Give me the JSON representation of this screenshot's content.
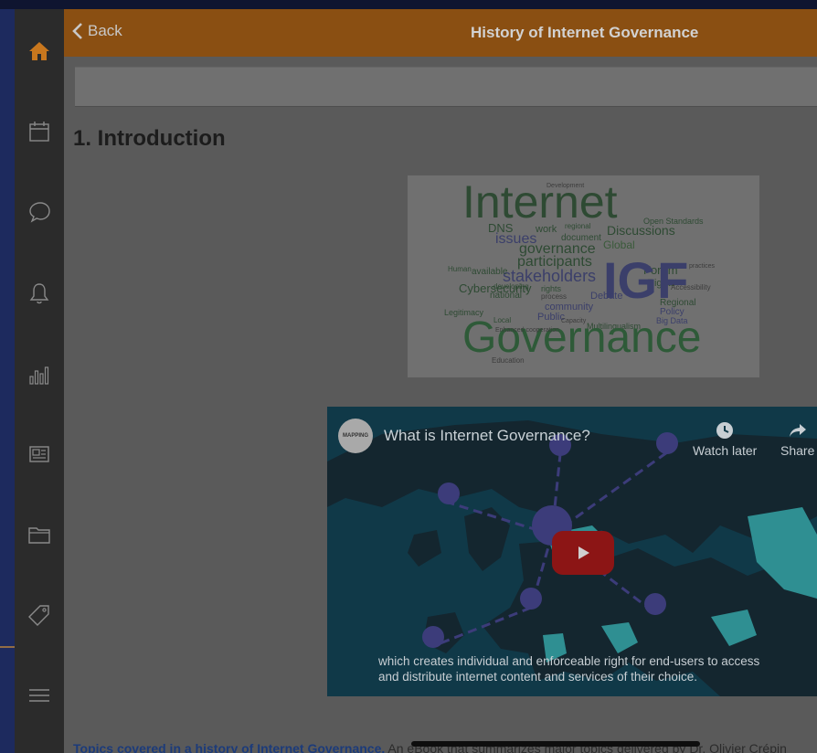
{
  "header": {
    "back_label": "Back",
    "title": "History of Internet Governance"
  },
  "sidebar": {
    "items": [
      {
        "icon": "home-icon",
        "active": true
      },
      {
        "icon": "calendar-icon"
      },
      {
        "icon": "chat-icon"
      },
      {
        "icon": "bell-icon"
      },
      {
        "icon": "bar-chart-icon"
      },
      {
        "icon": "news-icon"
      },
      {
        "icon": "folder-icon"
      },
      {
        "icon": "tag-icon"
      },
      {
        "icon": "menu-icon"
      }
    ]
  },
  "content": {
    "section_title": "1. Introduction",
    "wordcloud": {
      "words": [
        "Internet",
        "Development",
        "DNS",
        "work",
        "regional",
        "Open Standards",
        "Discussions",
        "issues",
        "document",
        "Global",
        "governance",
        "participants",
        "stakeholders",
        "Human",
        "available",
        "Cybersecurity",
        "Forum",
        "Rights",
        "IGF",
        "developing",
        "rights",
        "process",
        "national",
        "community",
        "Debate",
        "Regional",
        "Policy",
        "Legitimacy",
        "Local",
        "Public",
        "Big Data",
        "Capacity",
        "Multilingualism",
        "Governance",
        "Education",
        "Accessibility",
        "practices",
        "Enhanced cooperation"
      ]
    },
    "video": {
      "title": "What is Internet Governance?",
      "channel": "MAPPING",
      "watch_later": "Watch later",
      "share": "Share",
      "caption_line1": "which creates individual and enforceable right for end-users to access",
      "caption_line2": "and distribute internet content and services of their choice."
    },
    "footer": {
      "link_text": "Topics covered in a history of Internet Governance.",
      "body_text": " An eBook that summarizes major topics delivered by Dr. Olivier Crépin"
    }
  },
  "colors": {
    "header_bg": "#8a4f12",
    "sidebar_bg": "#2b2b2b",
    "active_icon": "#c8771e",
    "link": "#1c3b7a"
  }
}
